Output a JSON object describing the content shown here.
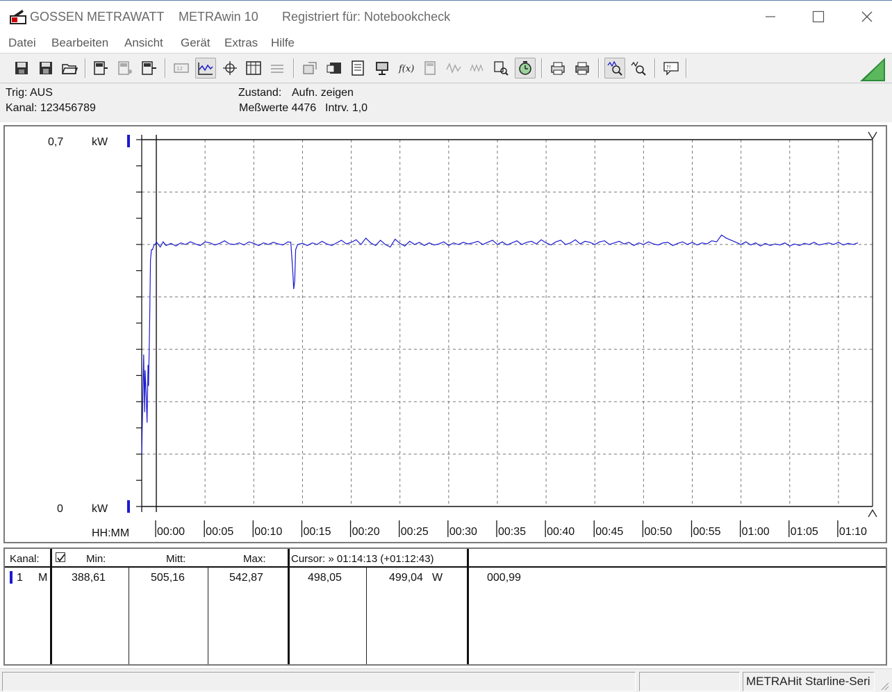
{
  "window": {
    "brand": "GOSSEN METRAWATT",
    "app_title": "METRAwin 10",
    "registered": "Registriert für: Notebookcheck"
  },
  "menu": [
    "Datei",
    "Bearbeiten",
    "Ansicht",
    "Gerät",
    "Extras",
    "Hilfe"
  ],
  "status_info": {
    "trig": "Trig: AUS",
    "kanal": "Kanal: 123456789",
    "zustand_label": "Zustand:",
    "zustand_value": "Aufn. zeigen",
    "messwerte": "Meßwerte 4476",
    "intervall": "Intrv. 1,0"
  },
  "chart_data": {
    "type": "line",
    "title": "",
    "xlabel": "HH:MM",
    "ylabel": "kW",
    "y_top_label": "0,7",
    "y_bottom_label": "0",
    "y_unit": "kW",
    "ylim": [
      0,
      0.7
    ],
    "xlim_minutes": [
      -1.5,
      73.5
    ],
    "x_ticks": [
      "00:00",
      "00:05",
      "00:10",
      "00:15",
      "00:20",
      "00:25",
      "00:30",
      "00:35",
      "00:40",
      "00:45",
      "00:50",
      "00:55",
      "01:00",
      "01:05",
      "01:10"
    ],
    "grid": true,
    "series": [
      {
        "color": "#1a1ad0",
        "x_minutes": [
          -1.5,
          -1.3,
          -1.2,
          -1.15,
          -1.05,
          -0.95,
          -0.85,
          -0.8,
          -0.7,
          -0.6,
          -0.5,
          -0.4,
          -0.3,
          -0.2,
          -0.1,
          0.0,
          0.2,
          0.4,
          0.7,
          1.0,
          1.5,
          2.0,
          2.5,
          3.0,
          3.5,
          4.0,
          4.5,
          5.0,
          5.5,
          6.0,
          6.5,
          7.0,
          7.5,
          8.0,
          8.5,
          9.0,
          9.5,
          10.0,
          10.5,
          11.0,
          11.5,
          12.0,
          12.5,
          13.0,
          13.5,
          13.8,
          14.0,
          14.1,
          14.2,
          14.3,
          14.5,
          15.0,
          15.5,
          16.0,
          16.5,
          17.0,
          17.5,
          18.0,
          18.5,
          19.0,
          19.5,
          20.0,
          20.5,
          21.0,
          21.5,
          22.0,
          22.5,
          23.0,
          23.5,
          24.0,
          24.5,
          25.0,
          25.5,
          26.0,
          26.5,
          27.0,
          27.5,
          28.0,
          28.5,
          29.0,
          29.5,
          30.0,
          30.5,
          31.0,
          31.5,
          32.0,
          32.5,
          33.0,
          33.5,
          34.0,
          34.5,
          35.0,
          35.5,
          36.0,
          36.5,
          37.0,
          37.5,
          38.0,
          38.5,
          39.0,
          39.5,
          40.0,
          40.5,
          41.0,
          41.5,
          42.0,
          42.5,
          43.0,
          43.5,
          44.0,
          44.5,
          45.0,
          45.5,
          46.0,
          46.5,
          47.0,
          47.5,
          48.0,
          48.5,
          49.0,
          49.5,
          50.0,
          50.5,
          51.0,
          51.5,
          52.0,
          52.5,
          53.0,
          53.5,
          54.0,
          54.5,
          55.0,
          55.5,
          56.0,
          56.5,
          57.0,
          57.5,
          58.0,
          58.5,
          59.0,
          59.5,
          60.0,
          60.5,
          61.0,
          61.5,
          62.0,
          62.5,
          63.0,
          63.5,
          64.0,
          64.5,
          65.0,
          65.5,
          66.0,
          66.5,
          67.0,
          67.5,
          68.0,
          68.5,
          69.0,
          69.5,
          70.0,
          70.5,
          71.0,
          71.5,
          72.0,
          72.5,
          73.0,
          73.5
        ],
        "values_kw": [
          0.1,
          0.29,
          0.18,
          0.26,
          0.22,
          0.16,
          0.27,
          0.23,
          0.33,
          0.47,
          0.49,
          0.49,
          0.495,
          0.5,
          0.5,
          0.505,
          0.5,
          0.495,
          0.505,
          0.498,
          0.502,
          0.497,
          0.503,
          0.5,
          0.505,
          0.501,
          0.498,
          0.505,
          0.503,
          0.499,
          0.502,
          0.507,
          0.501,
          0.5,
          0.503,
          0.499,
          0.505,
          0.502,
          0.498,
          0.503,
          0.5,
          0.504,
          0.501,
          0.499,
          0.505,
          0.504,
          0.45,
          0.415,
          0.43,
          0.49,
          0.5,
          0.502,
          0.498,
          0.503,
          0.5,
          0.506,
          0.501,
          0.498,
          0.503,
          0.508,
          0.501,
          0.504,
          0.509,
          0.5,
          0.512,
          0.503,
          0.498,
          0.508,
          0.5,
          0.495,
          0.51,
          0.502,
          0.497,
          0.506,
          0.5,
          0.504,
          0.498,
          0.503,
          0.499,
          0.501,
          0.505,
          0.498,
          0.503,
          0.5,
          0.504,
          0.501,
          0.503,
          0.506,
          0.5,
          0.504,
          0.508,
          0.5,
          0.505,
          0.499,
          0.503,
          0.507,
          0.5,
          0.504,
          0.506,
          0.501,
          0.509,
          0.503,
          0.499,
          0.505,
          0.508,
          0.5,
          0.503,
          0.509,
          0.501,
          0.506,
          0.504,
          0.5,
          0.505,
          0.507,
          0.5,
          0.503,
          0.506,
          0.501,
          0.504,
          0.498,
          0.503,
          0.5,
          0.505,
          0.501,
          0.499,
          0.503,
          0.504,
          0.498,
          0.502,
          0.505,
          0.5,
          0.504,
          0.499,
          0.503,
          0.501,
          0.507,
          0.505,
          0.518,
          0.512,
          0.508,
          0.504,
          0.5,
          0.505,
          0.499,
          0.503,
          0.497,
          0.502,
          0.498,
          0.501,
          0.499,
          0.503,
          0.497,
          0.501,
          0.498,
          0.502,
          0.5,
          0.504,
          0.499,
          0.501,
          0.503,
          0.5,
          0.504,
          0.499,
          0.502,
          0.5,
          0.503
        ]
      }
    ]
  },
  "table": {
    "headers": {
      "kanal": "Kanal:",
      "min": "Min:",
      "mitt": "Mitt:",
      "max": "Max:",
      "cursor": "Cursor: » 01:14:13 (+01:12:43)"
    },
    "row": {
      "channel": "1",
      "mode": "M",
      "min": "388,61",
      "mitt": "505,16",
      "max": "542,87",
      "cursor_val1": "498,05",
      "cursor_val2": "499,04",
      "unit": "W",
      "cursor_val3": "000,99"
    }
  },
  "statusbar": {
    "device": "METRAHit Starline-Seri"
  },
  "colors": {
    "series": "#1a1ad0",
    "toolbar_bg": "#f0f0f0",
    "accent_green": "#2e8b3a"
  },
  "icons": [
    "save-icon",
    "save-as-icon",
    "open-folder-icon",
    "device-icon",
    "print-icon",
    "zoom-icon",
    "settings-icon",
    "help-icon"
  ]
}
